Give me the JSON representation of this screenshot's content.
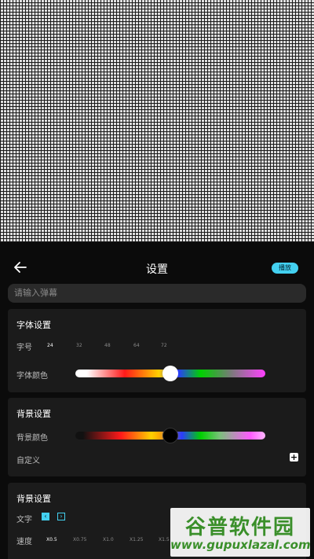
{
  "header": {
    "title": "设置",
    "play_label": "播放"
  },
  "input": {
    "placeholder": "请输入弹幕"
  },
  "font_card": {
    "title": "字体设置",
    "size_label": "字号",
    "size_options": [
      "24",
      "32",
      "48",
      "64",
      "72"
    ],
    "selected_size": "24",
    "color_label": "字体颜色",
    "color_slider_position": 0.5
  },
  "bg_card": {
    "title": "背景设置",
    "color_label": "背景颜色",
    "color_slider_position": 0.5,
    "custom_label": "自定义",
    "custom_add_icon": "plus-icon"
  },
  "scroll_card": {
    "title": "背景设置",
    "text_label": "文字",
    "speed_label": "速度",
    "speed_options": [
      "X0.5",
      "X0.75",
      "X1.0",
      "X1.25",
      "X1.5"
    ],
    "selected_speed": "X0.5"
  },
  "watermark": {
    "title": "谷普软件园",
    "url": "www.gupuxlazal.com"
  },
  "colors": {
    "accent": "#43d0f0",
    "panel_bg": "#0b0b0b",
    "card_bg": "#1b1b1b"
  }
}
